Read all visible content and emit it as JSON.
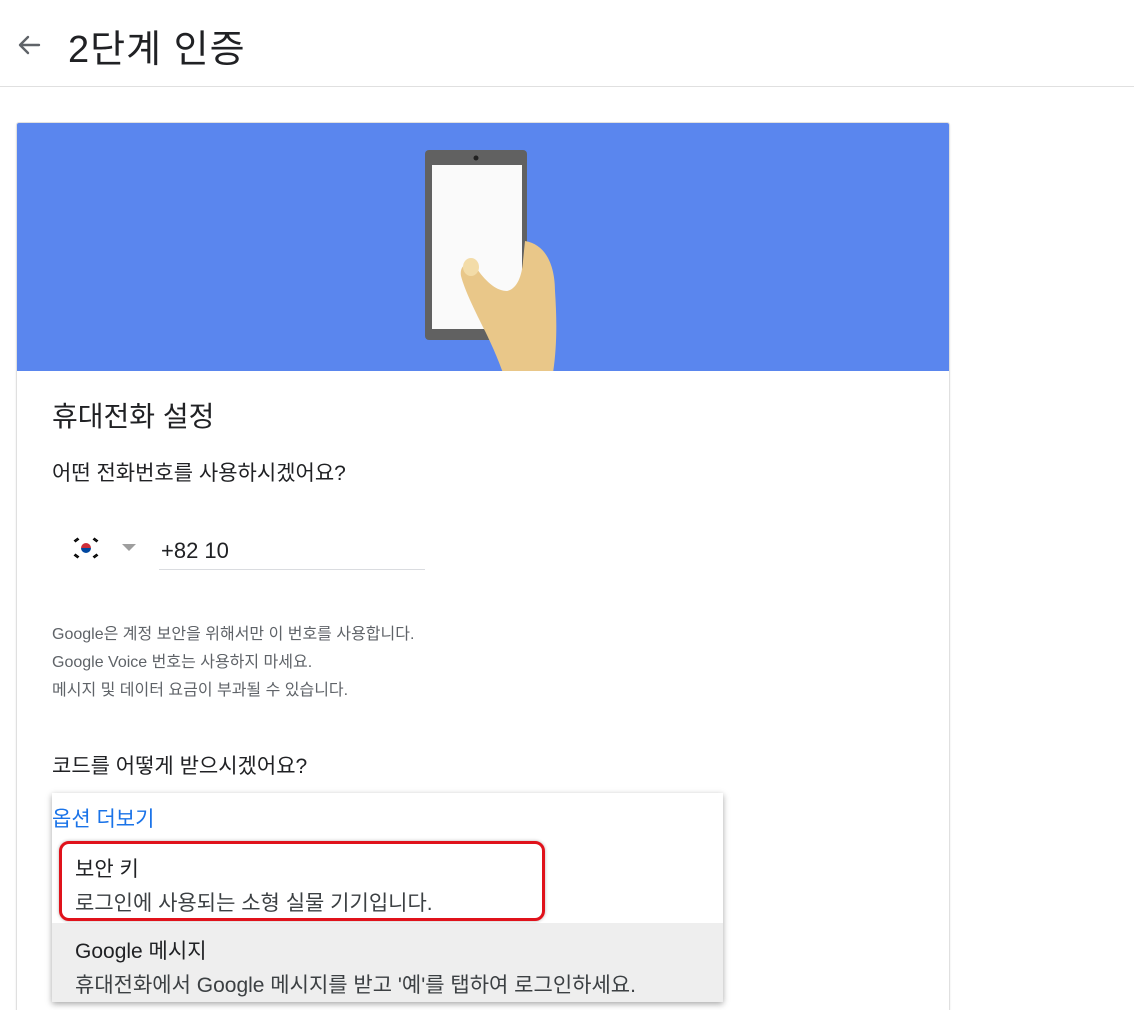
{
  "header": {
    "title": "2단계 인증"
  },
  "card": {
    "section_title": "휴대전화 설정",
    "phone_question": "어떤 전화번호를 사용하시겠어요?",
    "phone": {
      "value": "+82 10"
    },
    "notes": [
      "Google은 계정 보안을 위해서만 이 번호를 사용합니다.",
      "Google Voice 번호는 사용하지 마세요.",
      "메시지 및 데이터 요금이 부과될 수 있습니다."
    ],
    "code_question": "코드를 어떻게 받으시겠어요?",
    "dropdown": {
      "more_options": "옵션 더보기",
      "options": [
        {
          "title": "보안 키",
          "desc": "로그인에 사용되는 소형 실물 기기입니다."
        },
        {
          "title": "Google 메시지",
          "desc": "휴대전화에서 Google 메시지를 받고 '예'를 탭하여 로그인하세요."
        }
      ]
    }
  },
  "colors": {
    "banner": "#5a86ee",
    "link": "#1a73e8",
    "highlight": "#e0121b"
  }
}
